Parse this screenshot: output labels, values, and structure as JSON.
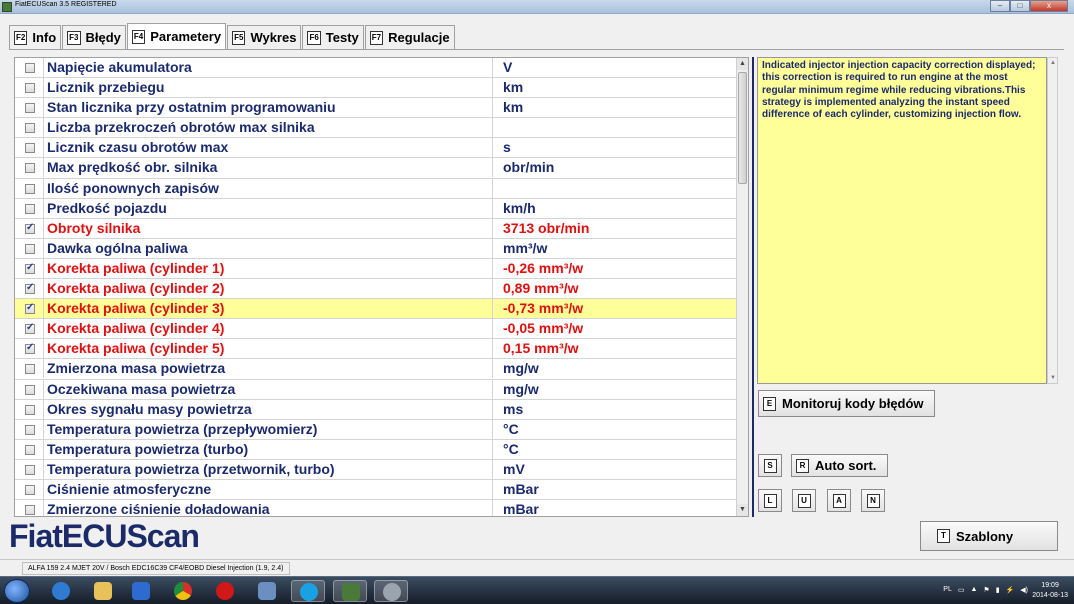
{
  "window": {
    "title": "FiatECUScan 3.5 REGISTERED",
    "controls": {
      "minimize": "–",
      "maximize": "□",
      "close": "x"
    }
  },
  "tabs": [
    {
      "key": "F2",
      "label": "Info",
      "active": false
    },
    {
      "key": "F3",
      "label": "Błędy",
      "active": false
    },
    {
      "key": "F4",
      "label": "Parametery",
      "active": true
    },
    {
      "key": "F5",
      "label": "Wykres",
      "active": false
    },
    {
      "key": "F6",
      "label": "Testy",
      "active": false
    },
    {
      "key": "F7",
      "label": "Regulacje",
      "active": false
    }
  ],
  "parameters": [
    {
      "name": "Napięcie akumulatora",
      "value": "V",
      "checked": false,
      "highlighted": false
    },
    {
      "name": "Licznik przebiegu",
      "value": "km",
      "checked": false,
      "highlighted": false
    },
    {
      "name": "Stan licznika przy ostatnim programowaniu",
      "value": "km",
      "checked": false,
      "highlighted": false
    },
    {
      "name": "Liczba przekroczeń obrotów max silnika",
      "value": "",
      "checked": false,
      "highlighted": false
    },
    {
      "name": "Licznik czasu obrotów max",
      "value": "s",
      "checked": false,
      "highlighted": false
    },
    {
      "name": "Max prędkość obr. silnika",
      "value": "obr/min",
      "checked": false,
      "highlighted": false
    },
    {
      "name": "Ilość ponownych zapisów",
      "value": "",
      "checked": false,
      "highlighted": false
    },
    {
      "name": "Predkość pojazdu",
      "value": "km/h",
      "checked": false,
      "highlighted": false
    },
    {
      "name": "Obroty silnika",
      "value": "3713 obr/min",
      "checked": true,
      "highlighted": false
    },
    {
      "name": "Dawka ogólna paliwa",
      "value": "mm³/w",
      "checked": false,
      "highlighted": false
    },
    {
      "name": "Korekta paliwa (cylinder 1)",
      "value": "-0,26 mm³/w",
      "checked": true,
      "highlighted": false
    },
    {
      "name": "Korekta paliwa (cylinder 2)",
      "value": "0,89 mm³/w",
      "checked": true,
      "highlighted": false
    },
    {
      "name": "Korekta paliwa (cylinder 3)",
      "value": "-0,73 mm³/w",
      "checked": true,
      "highlighted": true
    },
    {
      "name": "Korekta paliwa (cylinder 4)",
      "value": "-0,05 mm³/w",
      "checked": true,
      "highlighted": false
    },
    {
      "name": "Korekta paliwa (cylinder 5)",
      "value": "0,15 mm³/w",
      "checked": true,
      "highlighted": false
    },
    {
      "name": "Zmierzona masa powietrza",
      "value": "mg/w",
      "checked": false,
      "highlighted": false
    },
    {
      "name": "Oczekiwana masa powietrza",
      "value": "mg/w",
      "checked": false,
      "highlighted": false
    },
    {
      "name": "Okres sygnału masy powietrza",
      "value": "ms",
      "checked": false,
      "highlighted": false
    },
    {
      "name": "Temperatura powietrza (przepływomierz)",
      "value": "°C",
      "checked": false,
      "highlighted": false
    },
    {
      "name": "Temperatura powietrza (turbo)",
      "value": "°C",
      "checked": false,
      "highlighted": false
    },
    {
      "name": "Temperatura powietrza (przetwornik, turbo)",
      "value": "mV",
      "checked": false,
      "highlighted": false
    },
    {
      "name": "Ciśnienie atmosferyczne",
      "value": "mBar",
      "checked": false,
      "highlighted": false
    },
    {
      "name": "Zmierzone ciśnienie doładowania",
      "value": "mBar",
      "checked": false,
      "highlighted": false
    }
  ],
  "description": "Indicated injector injection capacity correction displayed; this correction is required to run engine at the most regular minimum regime while reducing vibrations.This strategy is implemented analyzing the instant speed difference of each cylinder, customizing injection flow.",
  "buttons": {
    "monitor": {
      "key": "E",
      "label": "Monitoruj kody błędów"
    },
    "s": {
      "key": "S"
    },
    "autosort": {
      "key": "R",
      "label": "Auto sort."
    },
    "l": {
      "key": "L"
    },
    "u": {
      "key": "U"
    },
    "a": {
      "key": "A"
    },
    "n": {
      "key": "N"
    },
    "templates": {
      "key": "T",
      "label": "Szablony"
    }
  },
  "logo": "FiatECUScan",
  "status": "ALFA 159 2.4 MJET 20V / Bosch EDC16C39 CF4/EOBD Diesel Injection (1.9, 2.4)",
  "taskbar": {
    "tray_lang": "PL",
    "time": "19:09",
    "date": "2014-08-13"
  },
  "colors": {
    "selected_text": "#e01010",
    "normal_text": "#1a2a6c",
    "highlight_row": "#ffff99",
    "description_bg": "#ffff99"
  }
}
